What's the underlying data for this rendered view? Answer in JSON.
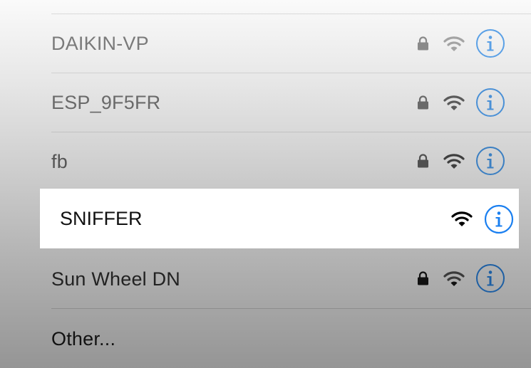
{
  "networks": [
    {
      "name": "DAIKIN-VP",
      "secured": true,
      "text_color": "#7a7a7a",
      "icon_color": "#8a8a8a",
      "wifi_color": "#a3a3a3",
      "info_color": "#5aa0e6"
    },
    {
      "name": "ESP_9F5FR",
      "secured": true,
      "text_color": "#6a6a6a",
      "icon_color": "#6a6a6a",
      "wifi_color": "#5a5a5a",
      "info_color": "#4a90d6"
    },
    {
      "name": "fb",
      "secured": true,
      "text_color": "#555555",
      "icon_color": "#505050",
      "wifi_color": "#3e3e3e",
      "info_color": "#3b7fc2"
    },
    {
      "name": "SNIFFER",
      "secured": false,
      "selected": true,
      "text_color": "#111111",
      "icon_color": "#000000",
      "wifi_color": "#000000",
      "info_color": "#1a7ff0"
    },
    {
      "name": "Sun Wheel DN",
      "secured": true,
      "text_color": "#222222",
      "icon_color": "#111111",
      "wifi_color": "#3a3a3a",
      "info_color": "#1e5fa3"
    }
  ],
  "other_label": "Other...",
  "icons": {
    "lock": "lock-icon",
    "wifi": "wifi-signal-icon",
    "info": "info-icon"
  }
}
